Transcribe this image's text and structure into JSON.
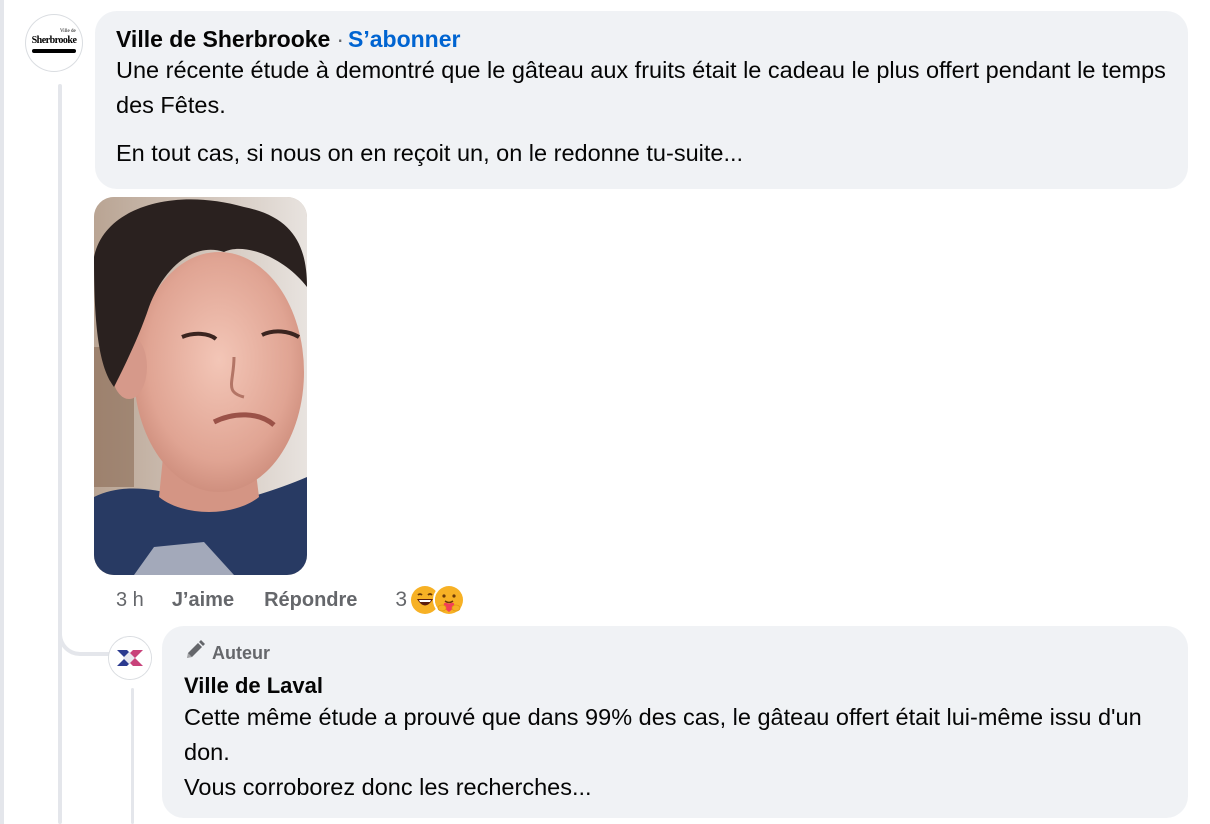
{
  "main_comment": {
    "logo_small_text": "Ville de",
    "logo_text": "Sherbrooke",
    "author": "Ville de Sherbrooke",
    "separator": "·",
    "follow_label": "S’abonner",
    "paragraphs": [
      "Une récente étude à demontré que le gâteau aux fruits était le cadeau le plus offert pendant le temps des Fêtes.",
      "En tout cas, si nous on en reçoit un, on le redonne tu-suite..."
    ],
    "attachment": "gif-image",
    "actions": {
      "time": "3 h",
      "like_label": "J’aime",
      "reply_label": "Répondre"
    },
    "reactions": {
      "count": "3",
      "icons": [
        "laughing-emoji-icon",
        "care-emoji-icon"
      ]
    }
  },
  "reply": {
    "badge_label": "Auteur",
    "badge_icon": "pencil-icon",
    "author": "Ville de Laval",
    "text": "Cette même étude a prouvé que dans 99% des cas, le gâteau offert était lui-même issu d'un don.\nVous corroborez donc les recherches..."
  },
  "colors": {
    "bubble_bg": "#f0f2f5",
    "link_blue": "#0064d1",
    "meta_gray": "#65676b",
    "text": "#050505"
  }
}
